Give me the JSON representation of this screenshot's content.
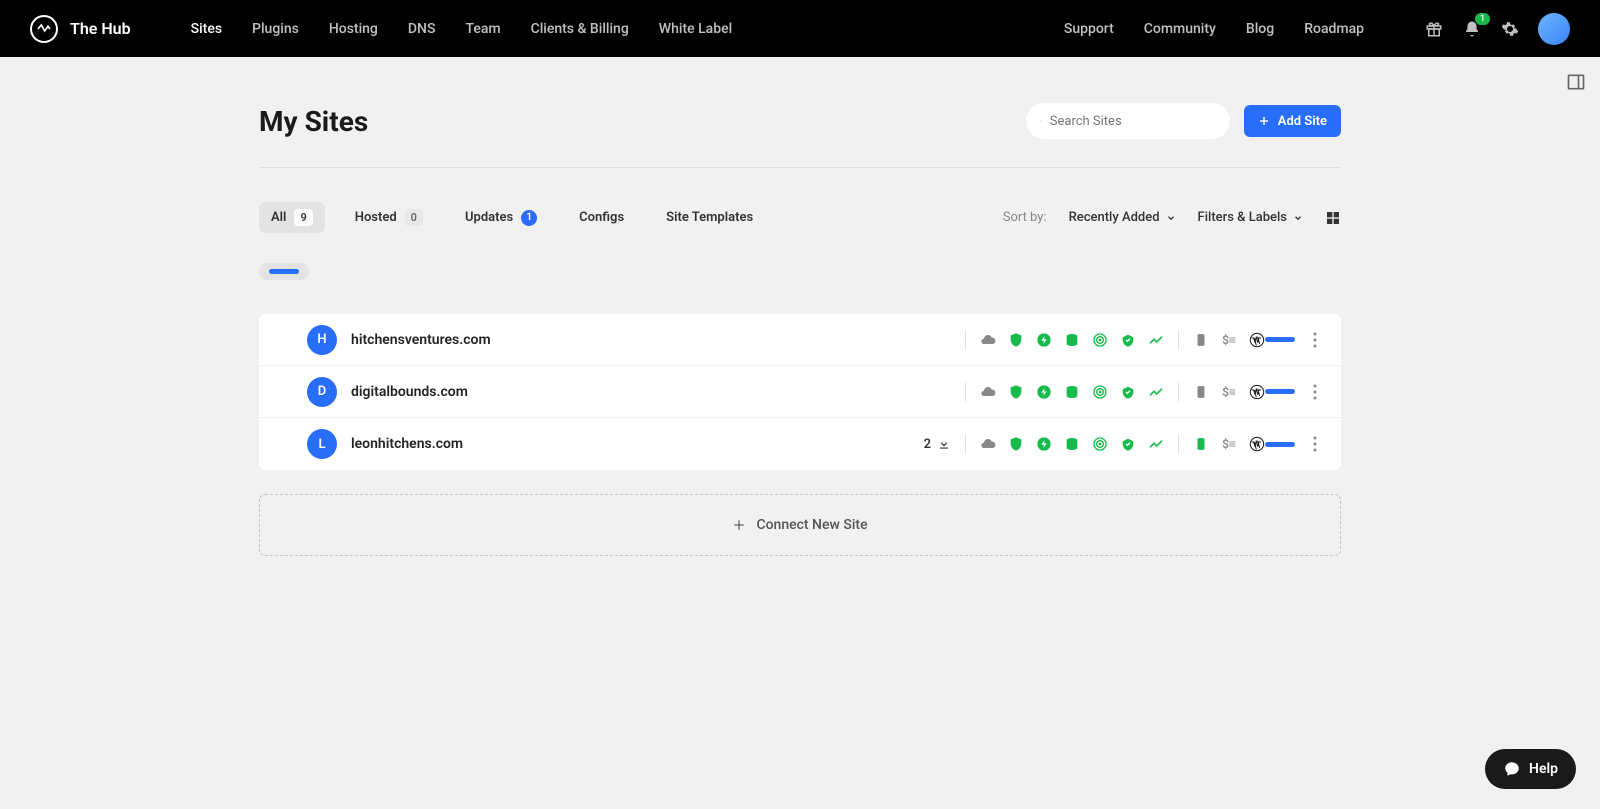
{
  "brand": {
    "name": "The Hub"
  },
  "nav_main": [
    "Sites",
    "Plugins",
    "Hosting",
    "DNS",
    "Team",
    "Clients & Billing",
    "White Label"
  ],
  "nav_right": [
    "Support",
    "Community",
    "Blog",
    "Roadmap"
  ],
  "notif_count": "1",
  "page": {
    "title": "My Sites",
    "search_placeholder": "Search Sites",
    "add_site_label": "Add Site",
    "connect_new_label": "Connect New Site"
  },
  "filters": {
    "tabs": [
      {
        "label": "All",
        "count": "9"
      },
      {
        "label": "Hosted",
        "count": "0"
      },
      {
        "label": "Updates",
        "count": "1"
      },
      {
        "label": "Configs"
      },
      {
        "label": "Site Templates"
      }
    ],
    "sort_label": "Sort by:",
    "sort_value": "Recently Added",
    "filters_label": "Filters & Labels"
  },
  "sites": [
    {
      "initial": "H",
      "name": "hitchensventures.com",
      "updates": null,
      "backup_green": false
    },
    {
      "initial": "D",
      "name": "digitalbounds.com",
      "updates": null,
      "backup_green": false
    },
    {
      "initial": "L",
      "name": "leonhitchens.com",
      "updates": "2",
      "backup_green": true
    }
  ],
  "help_label": "Help",
  "colors": {
    "accent": "#286efa",
    "success": "#18bb4b"
  }
}
